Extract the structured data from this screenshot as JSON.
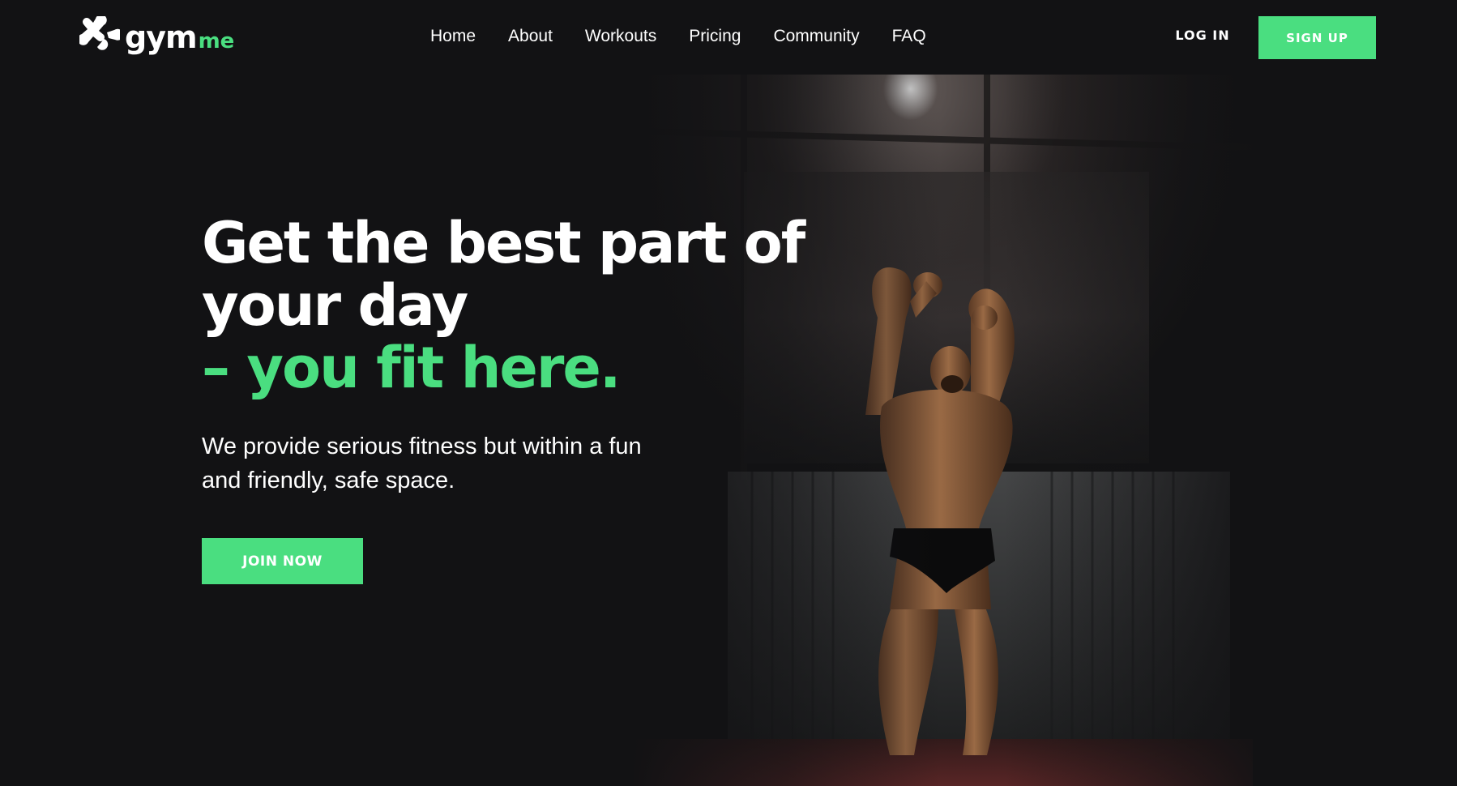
{
  "brand": {
    "name_main": "gym",
    "name_accent": "me",
    "logo_icon": "dumbbell-knot-icon",
    "accent_color": "#4ade80",
    "background_color": "#121214"
  },
  "nav": {
    "items": [
      {
        "label": "Home"
      },
      {
        "label": "About"
      },
      {
        "label": "Workouts"
      },
      {
        "label": "Pricing"
      },
      {
        "label": "Community"
      },
      {
        "label": "FAQ"
      }
    ],
    "login_label": "LOG IN",
    "signup_label": "SIGN UP"
  },
  "hero": {
    "headline_line1": "Get the best part of",
    "headline_line2": "your day",
    "headline_accent": "– you fit here.",
    "subtext": "We provide serious fitness but within a fun and friendly, safe space.",
    "cta_label": "JOIN NOW",
    "image_subject": "bodybuilder-posing-photo"
  }
}
